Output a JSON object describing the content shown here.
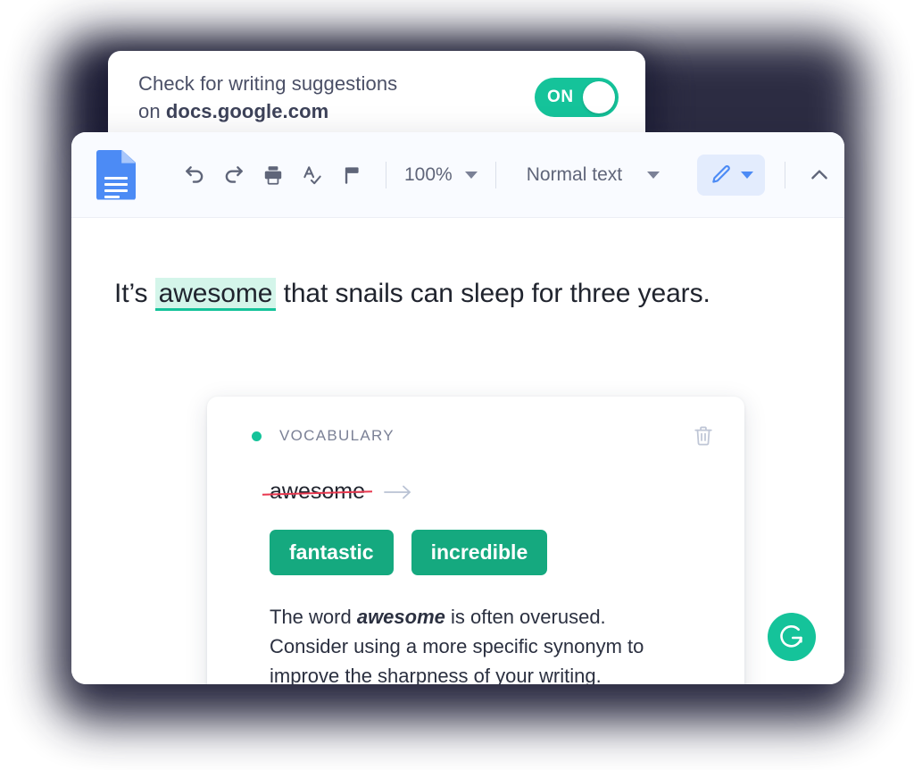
{
  "popup": {
    "line1": "Check for writing suggestions",
    "line2_prefix": "on ",
    "domain": "docs.google.com",
    "toggle_label": "ON",
    "toggle_state": "on",
    "accent_color": "#15c39a"
  },
  "toolbar": {
    "app_icon": "google-docs-icon",
    "undo_label": "Undo",
    "redo_label": "Redo",
    "print_label": "Print",
    "spellcheck_label": "Spelling and grammar check",
    "paint_format_label": "Paint format",
    "zoom_value": "100%",
    "style_value": "Normal text",
    "edit_mode_label": "Editing",
    "collapse_label": "Hide the menus"
  },
  "document": {
    "text_before": "It’s ",
    "highlighted_word": "awesome",
    "text_after": " that snails can sleep for three years.",
    "highlight_color": "#d4f5ea",
    "underline_color": "#15c39a"
  },
  "suggestion": {
    "category": "VOCABULARY",
    "dot_color": "#15c39a",
    "delete_label": "Dismiss suggestion",
    "original_word": "awesome",
    "strike_color": "#e8384f",
    "arrow": "→",
    "replacements": [
      "fantastic",
      "incredible"
    ],
    "chip_color": "#15a97f",
    "explanation_lines": [
      "The word awesome is often overused.",
      "Consider using a more specific synonym",
      "to improve the sharpness of your writing."
    ],
    "explanation_prefix": "The word ",
    "explanation_bold": "awesome",
    "explanation_rest": " is often overused. Consider using a more specific synonym to improve the sharpness of your writing."
  },
  "fab": {
    "label": "Grammarly",
    "color": "#15c39a"
  }
}
